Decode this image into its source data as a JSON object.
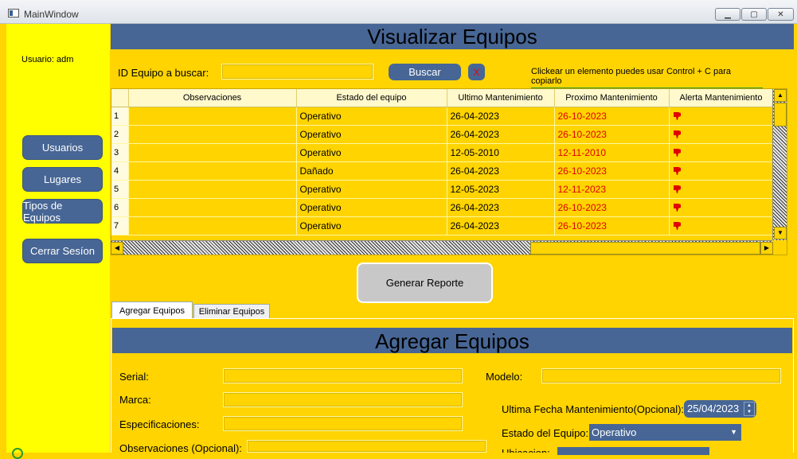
{
  "window": {
    "title": "MainWindow",
    "min_glyph": "▁",
    "max_glyph": "▢",
    "close_glyph": "✕"
  },
  "sidebar": {
    "user_label": "Usuario: adm",
    "items": [
      {
        "label": "Usuarios"
      },
      {
        "label": "Lugares"
      },
      {
        "label": "Tipos de Equipos"
      },
      {
        "label": "Cerrar Sesíon"
      }
    ]
  },
  "header": {
    "title": "Visualizar Equipos"
  },
  "search": {
    "label": "ID Equipo a buscar:",
    "value": "",
    "button": "Buscar",
    "clear": "X",
    "hint": "Clickear un elemento puedes usar Control + C para copiarlo"
  },
  "table": {
    "columns": [
      "Observaciones",
      "Estado del equipo",
      "Ultimo Mantenimiento",
      "Proximo Mantenimiento",
      "Alerta Mantenimiento"
    ],
    "rows": [
      {
        "n": "1",
        "obs": "",
        "estado": "Operativo",
        "ultimo": "26-04-2023",
        "proximo": "26-10-2023"
      },
      {
        "n": "2",
        "obs": "",
        "estado": "Operativo",
        "ultimo": "26-04-2023",
        "proximo": "26-10-2023"
      },
      {
        "n": "3",
        "obs": "",
        "estado": "Operativo",
        "ultimo": "12-05-2010",
        "proximo": "12-11-2010"
      },
      {
        "n": "4",
        "obs": "",
        "estado": "Dañado",
        "ultimo": "26-04-2023",
        "proximo": "26-10-2023"
      },
      {
        "n": "5",
        "obs": "",
        "estado": "Operativo",
        "ultimo": "12-05-2023",
        "proximo": "12-11-2023"
      },
      {
        "n": "6",
        "obs": "",
        "estado": "Operativo",
        "ultimo": "26-04-2023",
        "proximo": "26-10-2023"
      },
      {
        "n": "7",
        "obs": "",
        "estado": "Operativo",
        "ultimo": "26-04-2023",
        "proximo": "26-10-2023"
      }
    ],
    "alert_icon": "thumbs-down-icon",
    "alert_color": "#e00000"
  },
  "report_button": "Generar Reporte",
  "tabs": [
    {
      "label": "Agregar Equipos",
      "active": true
    },
    {
      "label": "Eliminar Equipos",
      "active": false
    }
  ],
  "form": {
    "title": "Agregar Equipos",
    "serial_label": "Serial:",
    "marca_label": "Marca:",
    "especificaciones_label": "Especificaciones:",
    "observaciones_label": "Observaciones (Opcional):",
    "modelo_label": "Modelo:",
    "fecha_label": "Ultima Fecha Mantenimiento(Opcional):",
    "fecha_value": "25/04/2023",
    "estado_label": "Estado del  Equipo:",
    "estado_value": "Operativo",
    "ubicacion_label": "Ubicacion:"
  },
  "colors": {
    "accent": "#476695",
    "background": "#ffd400",
    "sidebar": "#ffff00",
    "alert": "#e00000"
  }
}
